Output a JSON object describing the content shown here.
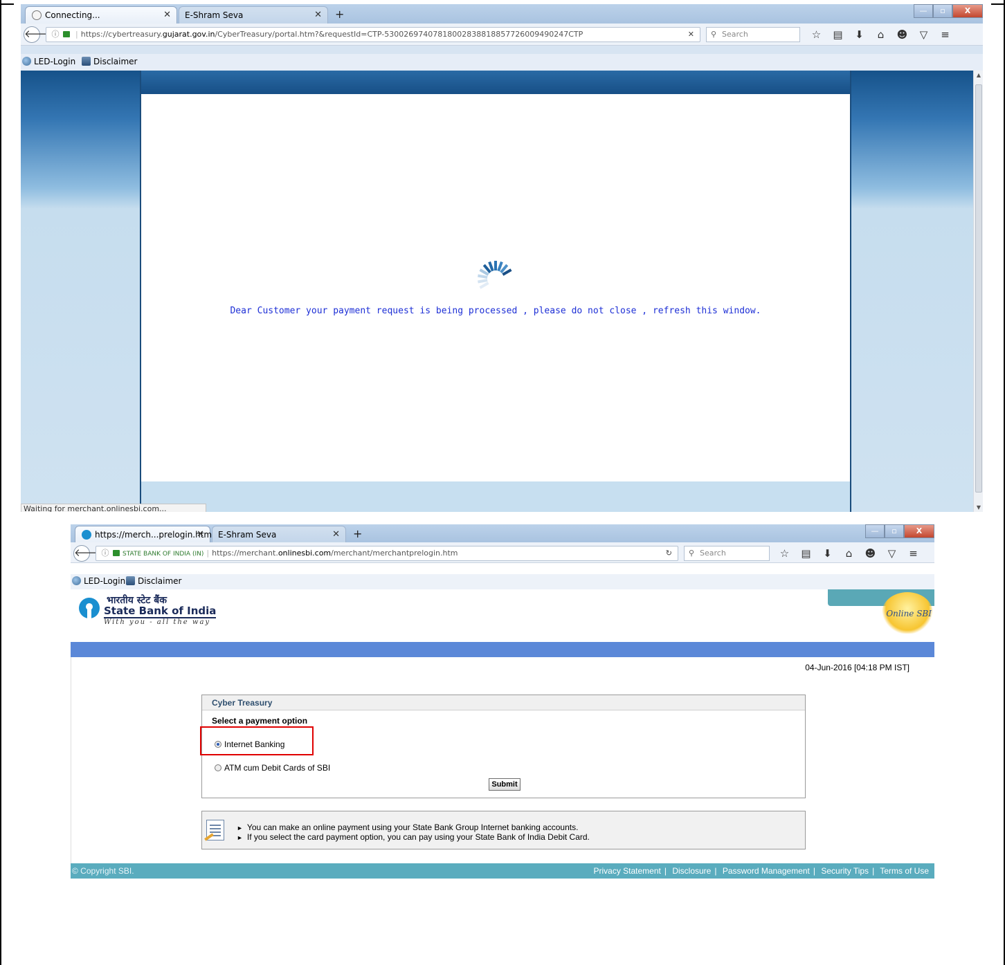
{
  "window1": {
    "tabs": [
      {
        "label": "Connecting..."
      },
      {
        "label": "E-Shram Seva"
      }
    ],
    "new_tab_symbol": "+",
    "url": {
      "prefix": "https://cybertreasury.",
      "host": "gujarat.gov.in",
      "suffix": "/CyberTreasury/portal.htm?&requestId=CTP-53002697407818002838818857726009490247CTP"
    },
    "search_placeholder": "Search",
    "bookmarks": [
      {
        "label": "LED-Login",
        "icon": "globe-icon"
      },
      {
        "label": "Disclaimer",
        "icon": "doc-icon"
      }
    ],
    "processing_message": "Dear Customer your payment request is being processed , please do not close , refresh this window.",
    "status_text": "Waiting for merchant.onlinesbi.com..."
  },
  "window2": {
    "tabs": [
      {
        "label": "https://merch...prelogin.htm"
      },
      {
        "label": "E-Shram Seva"
      }
    ],
    "new_tab_symbol": "+",
    "url": {
      "org": "STATE BANK OF INDIA (IN)",
      "prefix": "https://merchant.",
      "host": "onlinesbi.com",
      "suffix": "/merchant/merchantprelogin.htm"
    },
    "search_placeholder": "Search",
    "bookmarks": [
      {
        "label": "LED-Login",
        "icon": "globe-icon"
      },
      {
        "label": "Disclaimer",
        "icon": "doc-icon"
      }
    ],
    "bank": {
      "hindi_name": "भारतीय स्टेट बैंक",
      "name": "State Bank of India",
      "tagline": "With you - all the way",
      "online_logo_text": "Online SBI"
    },
    "date": "04-Jun-2016 [04:18 PM IST]",
    "panel": {
      "title": "Cyber Treasury",
      "subtitle": "Select a payment option",
      "options": [
        {
          "label": "Internet Banking",
          "selected": true
        },
        {
          "label": "ATM cum Debit Cards of SBI",
          "selected": false
        }
      ],
      "submit_label": "Submit"
    },
    "info": [
      "You can make an online payment using your State Bank Group Internet banking accounts.",
      "If you select the card payment option, you can pay using your State Bank of India Debit Card."
    ],
    "footer": {
      "copyright": "© Copyright SBI.",
      "links": [
        "Privacy Statement",
        "Disclosure",
        "Password Management",
        "Security Tips",
        "Terms of Use"
      ]
    }
  },
  "colors": {
    "processing_text": "#1d2fd6",
    "sbi_bar": "#5b88d8",
    "sbi_footer": "#5aacbe",
    "highlight_box": "#e00000"
  }
}
